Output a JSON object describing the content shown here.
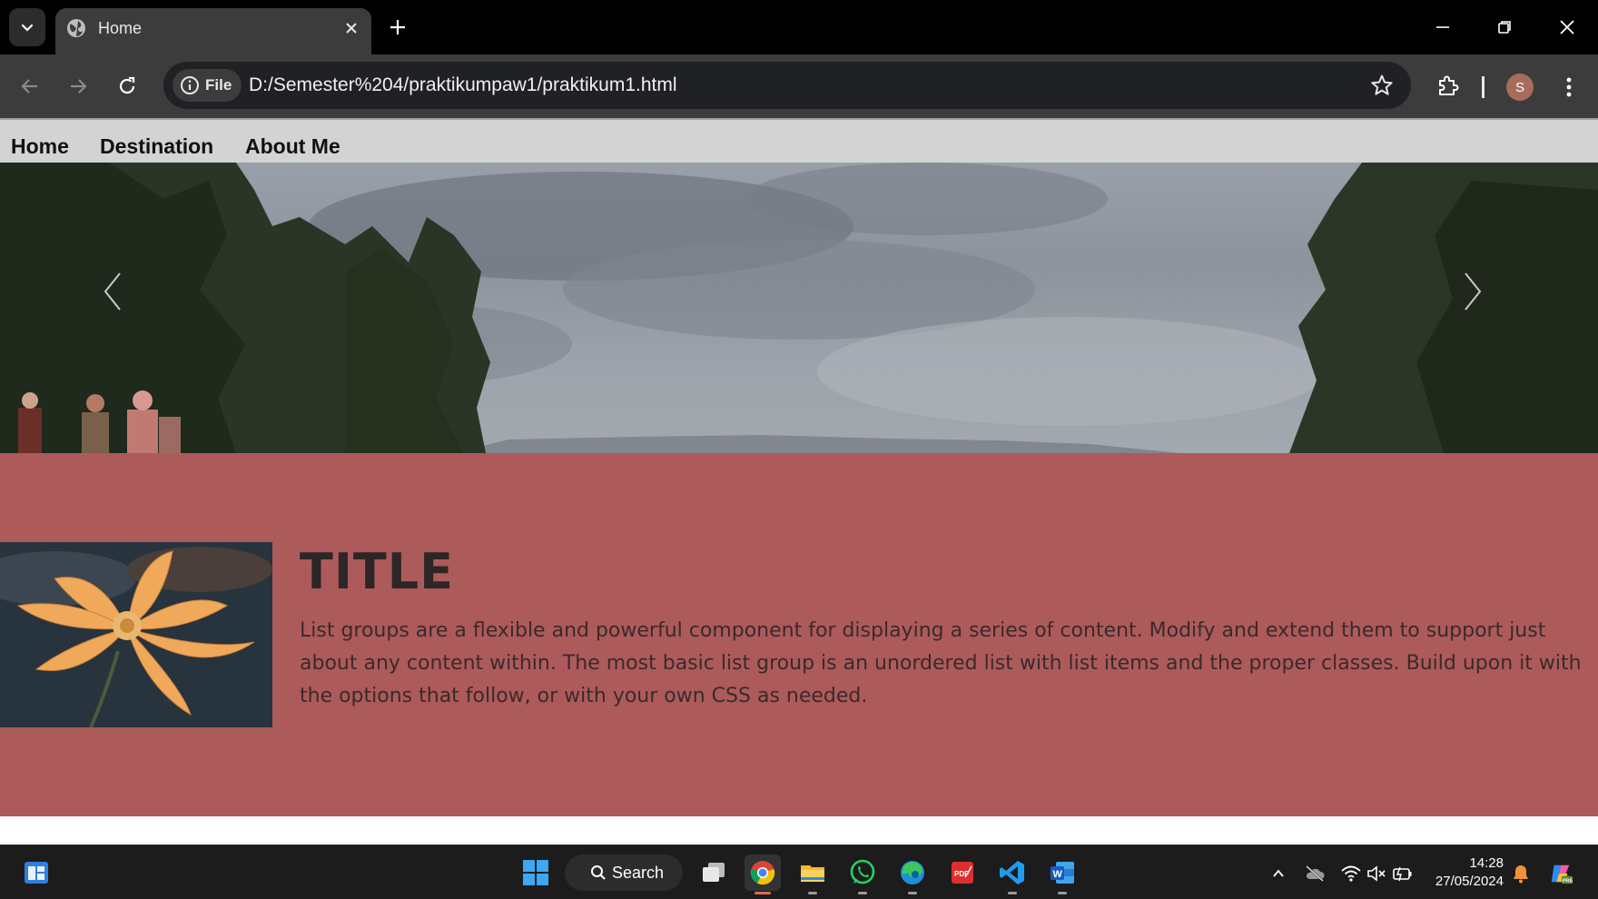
{
  "browser": {
    "tab": {
      "title": "Home"
    },
    "address_bar": {
      "site_info_label": "File",
      "url": "D:/Semester%204/praktikumpaw1/praktikum1.html"
    },
    "profile_initial": "S"
  },
  "site": {
    "nav": [
      {
        "label": "Home"
      },
      {
        "label": "Destination"
      },
      {
        "label": "About Me"
      }
    ],
    "feature": {
      "title": "TITLE",
      "body": "List groups are a flexible and powerful component for displaying a series of content. Modify and extend them to support just about any content within. The most basic list group is an unordered list with list items and the proper classes. Build upon it with the options that follow, or with your own CSS as needed."
    },
    "colors": {
      "nav_bg": "#d3d3d3",
      "feature_bg": "#ad5a5b"
    }
  },
  "taskbar": {
    "search_label": "Search",
    "apps": [
      "task-view",
      "chrome",
      "file-explorer",
      "whatsapp",
      "edge",
      "pdf-app",
      "vscode",
      "word"
    ],
    "clock": {
      "time": "14:28",
      "date": "27/05/2024"
    }
  }
}
